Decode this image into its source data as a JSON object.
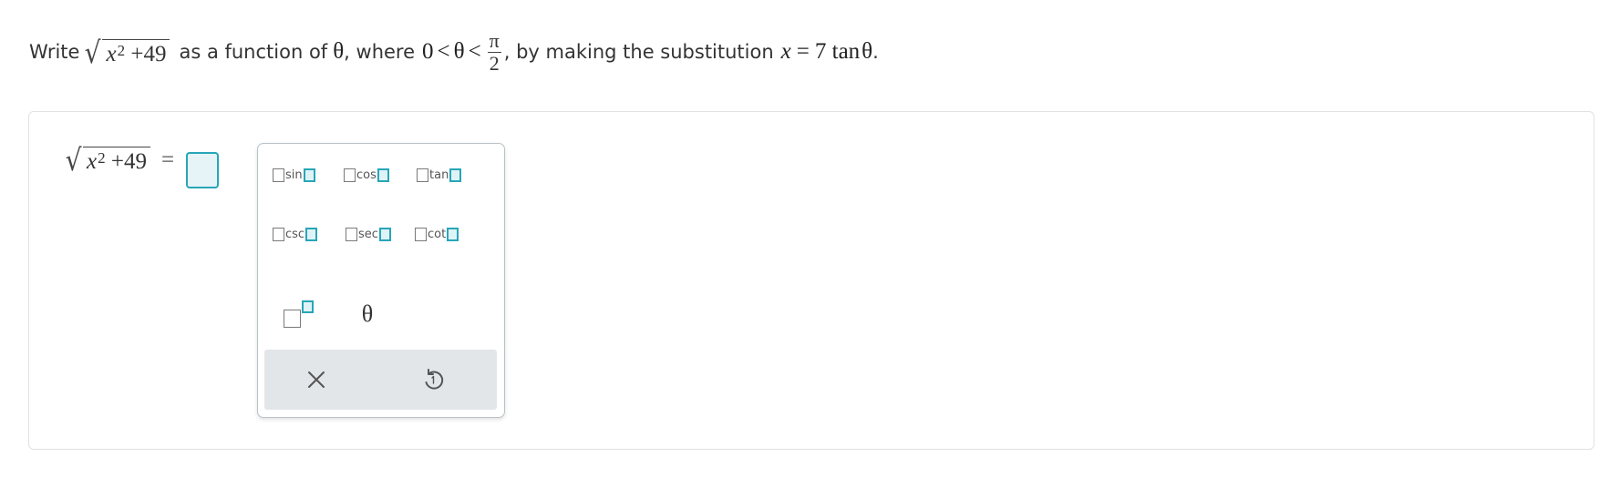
{
  "prompt": {
    "write": "Write",
    "var_x": "x",
    "exp_2": "2",
    "plus_49": "+49",
    "as_function_of": "as a function of",
    "theta": "θ",
    "where": ", where",
    "zero": "0",
    "lt": "<",
    "pi": "π",
    "two": "2",
    "by_making": ", by making the substitution",
    "equals": "=",
    "substitution_rhs": "7 tan",
    "period": "."
  },
  "answer": {
    "lhs_var": "x",
    "lhs_exp": "2",
    "lhs_plus": "+49",
    "equals": "="
  },
  "palette": {
    "functions": [
      "sin",
      "cos",
      "tan",
      "csc",
      "sec",
      "cot"
    ],
    "theta_button": "θ",
    "icons": {
      "power": "power-template-icon",
      "clear": "close-icon",
      "undo": "undo-icon"
    },
    "accent_color": "#27a6b7"
  }
}
